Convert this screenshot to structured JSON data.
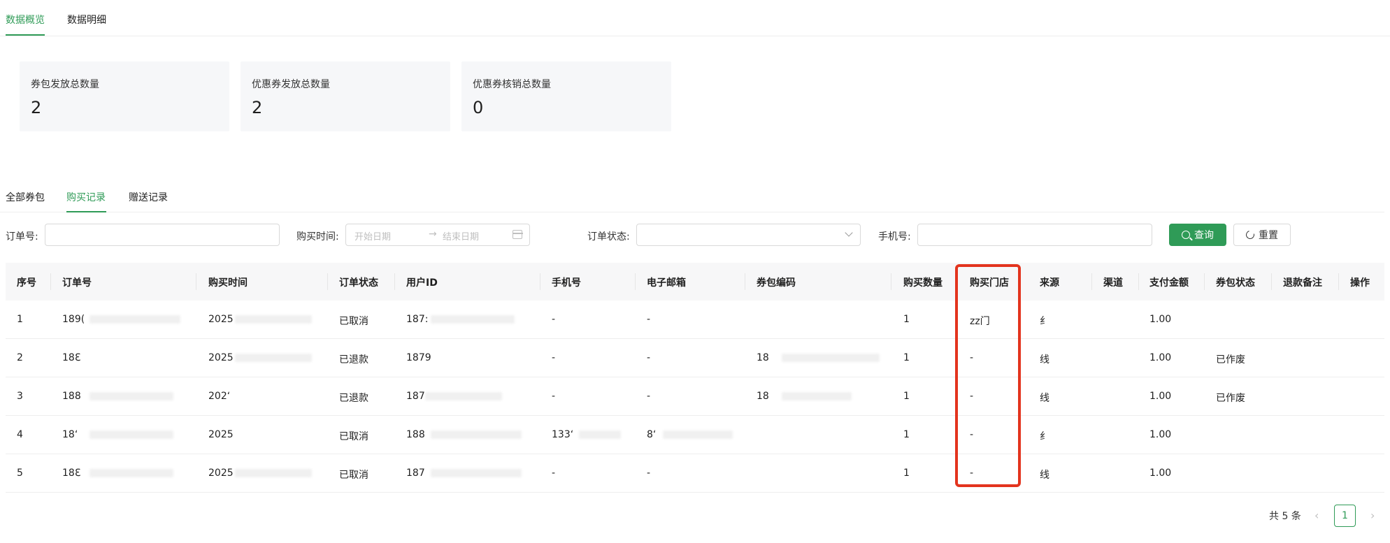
{
  "top_tabs": [
    "数据概览",
    "数据明细"
  ],
  "stats": [
    {
      "label": "券包发放总数量",
      "value": "2"
    },
    {
      "label": "优惠券发放总数量",
      "value": "2"
    },
    {
      "label": "优惠券核销总数量",
      "value": "0"
    }
  ],
  "sub_tabs": [
    "全部券包",
    "购买记录",
    "赠送记录"
  ],
  "filters": {
    "order_no_label": "订单号:",
    "time_label": "购买时间:",
    "start_placeholder": "开始日期",
    "arrow": "→",
    "end_placeholder": "结束日期",
    "status_label": "订单状态:",
    "phone_label": "手机号:",
    "query_label": "查询",
    "reset_label": "重置"
  },
  "columns": [
    "序号",
    "订单号",
    "购买时间",
    "订单状态",
    "用户ID",
    "手机号",
    "电子邮箱",
    "券包编码",
    "购买数量",
    "购买门店",
    "来源",
    "渠道",
    "支付金额",
    "券包状态",
    "退款备注",
    "操作"
  ],
  "rows": [
    {
      "idx": "1",
      "order": "189(",
      "time": "2025",
      "status": "已取消",
      "user": "187:",
      "phone": "-",
      "email": "-",
      "code": "",
      "qty": "1",
      "store": "zz门",
      "source": "纟",
      "amount": "1.00",
      "pkg_status": ""
    },
    {
      "idx": "2",
      "order": "18ℇ",
      "time": "2025",
      "status": "已退款",
      "user": "1879",
      "phone": "-",
      "email": "-",
      "code": "18",
      "qty": "1",
      "store": "-",
      "source": "线",
      "amount": "1.00",
      "pkg_status": "已作废"
    },
    {
      "idx": "3",
      "order": "188",
      "time": "202ʻ",
      "status": "已退款",
      "user": "187",
      "phone": "-",
      "email": "-",
      "code": "18",
      "qty": "1",
      "store": "-",
      "source": "线",
      "amount": "1.00",
      "pkg_status": "已作废"
    },
    {
      "idx": "4",
      "order": "18ʻ",
      "time": "2025",
      "status": "已取消",
      "user": "188",
      "phone": "133ʻ",
      "email": "8ʻ",
      "code": "",
      "qty": "1",
      "store": "-",
      "source": "纟",
      "amount": "1.00",
      "pkg_status": ""
    },
    {
      "idx": "5",
      "order": "18ℇ",
      "time": "2025",
      "status": "已取消",
      "user": "187",
      "phone": "-",
      "email": "-",
      "code": "",
      "qty": "1",
      "store": "-",
      "source": "线",
      "amount": "1.00",
      "pkg_status": ""
    }
  ],
  "pagination": {
    "total_label": "共 5 条",
    "prev": "‹",
    "page": "1",
    "next": "›"
  },
  "colors": {
    "accent": "#2f9b57",
    "highlight": "#e3341e"
  }
}
